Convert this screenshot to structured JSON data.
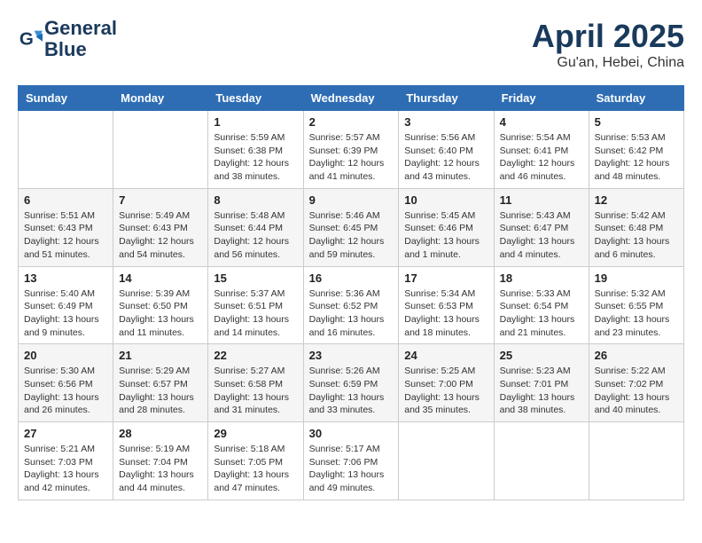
{
  "header": {
    "logo_line1": "General",
    "logo_line2": "Blue",
    "month_title": "April 2025",
    "location": "Gu'an, Hebei, China"
  },
  "weekdays": [
    "Sunday",
    "Monday",
    "Tuesday",
    "Wednesday",
    "Thursday",
    "Friday",
    "Saturday"
  ],
  "weeks": [
    [
      {
        "day": "",
        "info": ""
      },
      {
        "day": "",
        "info": ""
      },
      {
        "day": "1",
        "info": "Sunrise: 5:59 AM\nSunset: 6:38 PM\nDaylight: 12 hours\nand 38 minutes."
      },
      {
        "day": "2",
        "info": "Sunrise: 5:57 AM\nSunset: 6:39 PM\nDaylight: 12 hours\nand 41 minutes."
      },
      {
        "day": "3",
        "info": "Sunrise: 5:56 AM\nSunset: 6:40 PM\nDaylight: 12 hours\nand 43 minutes."
      },
      {
        "day": "4",
        "info": "Sunrise: 5:54 AM\nSunset: 6:41 PM\nDaylight: 12 hours\nand 46 minutes."
      },
      {
        "day": "5",
        "info": "Sunrise: 5:53 AM\nSunset: 6:42 PM\nDaylight: 12 hours\nand 48 minutes."
      }
    ],
    [
      {
        "day": "6",
        "info": "Sunrise: 5:51 AM\nSunset: 6:43 PM\nDaylight: 12 hours\nand 51 minutes."
      },
      {
        "day": "7",
        "info": "Sunrise: 5:49 AM\nSunset: 6:43 PM\nDaylight: 12 hours\nand 54 minutes."
      },
      {
        "day": "8",
        "info": "Sunrise: 5:48 AM\nSunset: 6:44 PM\nDaylight: 12 hours\nand 56 minutes."
      },
      {
        "day": "9",
        "info": "Sunrise: 5:46 AM\nSunset: 6:45 PM\nDaylight: 12 hours\nand 59 minutes."
      },
      {
        "day": "10",
        "info": "Sunrise: 5:45 AM\nSunset: 6:46 PM\nDaylight: 13 hours\nand 1 minute."
      },
      {
        "day": "11",
        "info": "Sunrise: 5:43 AM\nSunset: 6:47 PM\nDaylight: 13 hours\nand 4 minutes."
      },
      {
        "day": "12",
        "info": "Sunrise: 5:42 AM\nSunset: 6:48 PM\nDaylight: 13 hours\nand 6 minutes."
      }
    ],
    [
      {
        "day": "13",
        "info": "Sunrise: 5:40 AM\nSunset: 6:49 PM\nDaylight: 13 hours\nand 9 minutes."
      },
      {
        "day": "14",
        "info": "Sunrise: 5:39 AM\nSunset: 6:50 PM\nDaylight: 13 hours\nand 11 minutes."
      },
      {
        "day": "15",
        "info": "Sunrise: 5:37 AM\nSunset: 6:51 PM\nDaylight: 13 hours\nand 14 minutes."
      },
      {
        "day": "16",
        "info": "Sunrise: 5:36 AM\nSunset: 6:52 PM\nDaylight: 13 hours\nand 16 minutes."
      },
      {
        "day": "17",
        "info": "Sunrise: 5:34 AM\nSunset: 6:53 PM\nDaylight: 13 hours\nand 18 minutes."
      },
      {
        "day": "18",
        "info": "Sunrise: 5:33 AM\nSunset: 6:54 PM\nDaylight: 13 hours\nand 21 minutes."
      },
      {
        "day": "19",
        "info": "Sunrise: 5:32 AM\nSunset: 6:55 PM\nDaylight: 13 hours\nand 23 minutes."
      }
    ],
    [
      {
        "day": "20",
        "info": "Sunrise: 5:30 AM\nSunset: 6:56 PM\nDaylight: 13 hours\nand 26 minutes."
      },
      {
        "day": "21",
        "info": "Sunrise: 5:29 AM\nSunset: 6:57 PM\nDaylight: 13 hours\nand 28 minutes."
      },
      {
        "day": "22",
        "info": "Sunrise: 5:27 AM\nSunset: 6:58 PM\nDaylight: 13 hours\nand 31 minutes."
      },
      {
        "day": "23",
        "info": "Sunrise: 5:26 AM\nSunset: 6:59 PM\nDaylight: 13 hours\nand 33 minutes."
      },
      {
        "day": "24",
        "info": "Sunrise: 5:25 AM\nSunset: 7:00 PM\nDaylight: 13 hours\nand 35 minutes."
      },
      {
        "day": "25",
        "info": "Sunrise: 5:23 AM\nSunset: 7:01 PM\nDaylight: 13 hours\nand 38 minutes."
      },
      {
        "day": "26",
        "info": "Sunrise: 5:22 AM\nSunset: 7:02 PM\nDaylight: 13 hours\nand 40 minutes."
      }
    ],
    [
      {
        "day": "27",
        "info": "Sunrise: 5:21 AM\nSunset: 7:03 PM\nDaylight: 13 hours\nand 42 minutes."
      },
      {
        "day": "28",
        "info": "Sunrise: 5:19 AM\nSunset: 7:04 PM\nDaylight: 13 hours\nand 44 minutes."
      },
      {
        "day": "29",
        "info": "Sunrise: 5:18 AM\nSunset: 7:05 PM\nDaylight: 13 hours\nand 47 minutes."
      },
      {
        "day": "30",
        "info": "Sunrise: 5:17 AM\nSunset: 7:06 PM\nDaylight: 13 hours\nand 49 minutes."
      },
      {
        "day": "",
        "info": ""
      },
      {
        "day": "",
        "info": ""
      },
      {
        "day": "",
        "info": ""
      }
    ]
  ]
}
